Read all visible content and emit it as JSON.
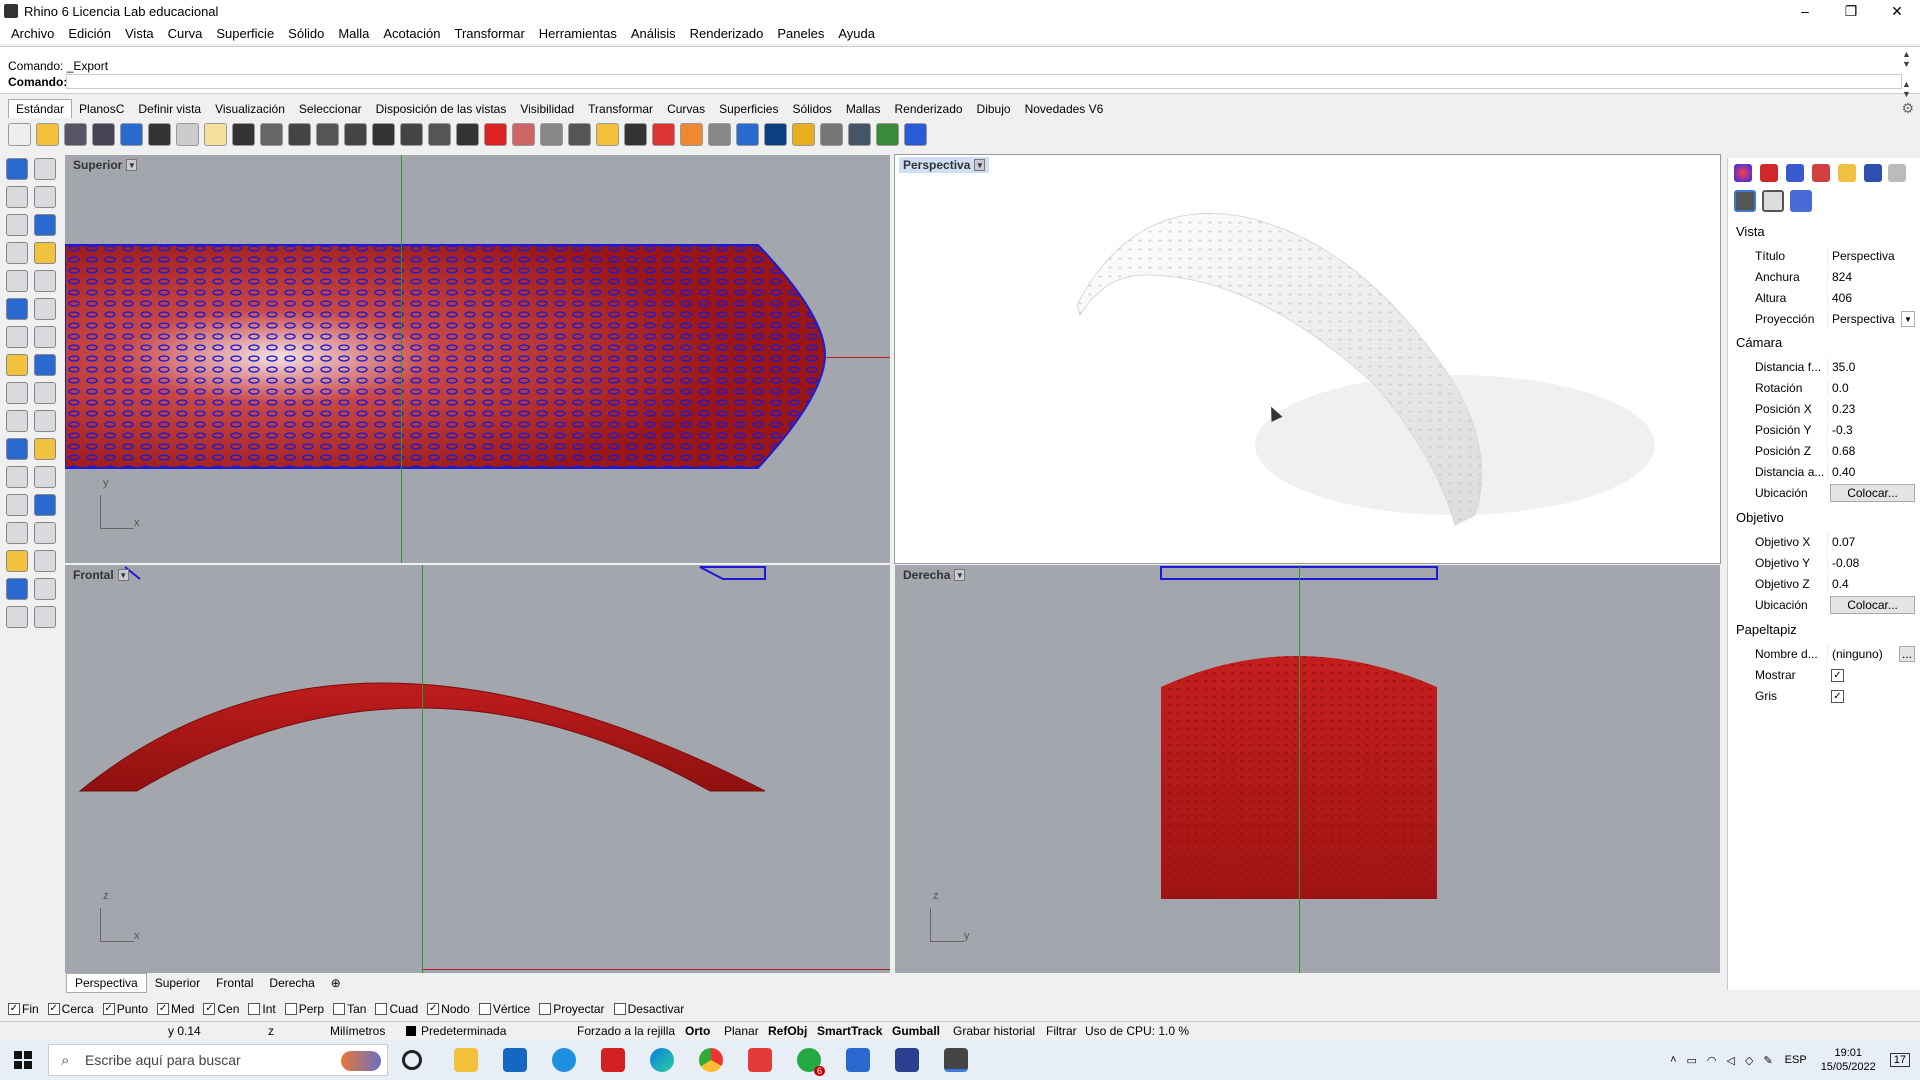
{
  "window": {
    "title": "Rhino 6 Licencia Lab educacional",
    "min": "–",
    "max": "❐",
    "close": "✕"
  },
  "menu": [
    "Archivo",
    "Edición",
    "Vista",
    "Curva",
    "Superficie",
    "Sólido",
    "Malla",
    "Acotación",
    "Transformar",
    "Herramientas",
    "Análisis",
    "Renderizado",
    "Paneles",
    "Ayuda"
  ],
  "command": {
    "history": "Comando: _Export",
    "prompt": "Comando:",
    "value": ""
  },
  "toolbar_tabs": [
    "Estándar",
    "PlanosC",
    "Definir vista",
    "Visualización",
    "Seleccionar",
    "Disposición de las vistas",
    "Visibilidad",
    "Transformar",
    "Curvas",
    "Superficies",
    "Sólidos",
    "Mallas",
    "Renderizado",
    "Dibujo",
    "Novedades V6"
  ],
  "toolbar_icons": [
    "new-icon",
    "open-icon",
    "save-icon",
    "print-icon",
    "import-icon",
    "cut-icon",
    "copy-icon",
    "paste-icon",
    "undo-icon",
    "pan-icon",
    "move-view-icon",
    "zoom-icon",
    "zoom-window-icon",
    "zoom-extents-icon",
    "zoom-selected-icon",
    "rotate-view-icon",
    "four-views-icon",
    "car-icon",
    "bus-icon",
    "cplane-icon",
    "grid-icon",
    "bulb-icon",
    "lock-icon",
    "layer-icon",
    "color-icon",
    "material-icon",
    "sphere-icon",
    "render-icon",
    "filter-icon",
    "gear-icon",
    "options-icon",
    "globe-icon",
    "help-icon"
  ],
  "viewports": {
    "top": {
      "label": "Superior"
    },
    "perspective": {
      "label": "Perspectiva"
    },
    "front": {
      "label": "Frontal"
    },
    "right": {
      "label": "Derecha"
    }
  },
  "gizmo": {
    "top": {
      "v": "y",
      "h": "x"
    },
    "front": {
      "v": "z",
      "h": "x"
    },
    "right": {
      "v": "z",
      "h": "y"
    }
  },
  "viewport_tabs": [
    "Perspectiva",
    "Superior",
    "Frontal",
    "Derecha"
  ],
  "viewport_tab_add": "⊕",
  "osnaps": [
    {
      "label": "Fin",
      "checked": true
    },
    {
      "label": "Cerca",
      "checked": true
    },
    {
      "label": "Punto",
      "checked": true
    },
    {
      "label": "Med",
      "checked": true
    },
    {
      "label": "Cen",
      "checked": true
    },
    {
      "label": "Int",
      "checked": false
    },
    {
      "label": "Perp",
      "checked": false
    },
    {
      "label": "Tan",
      "checked": false
    },
    {
      "label": "Cuad",
      "checked": false
    },
    {
      "label": "Nodo",
      "checked": true
    },
    {
      "label": "Vértice",
      "checked": false
    },
    {
      "label": "Proyectar",
      "checked": false
    },
    {
      "label": "Desactivar",
      "checked": false
    }
  ],
  "status": {
    "y": "y 0.14",
    "z": "z",
    "units": "Milímetros",
    "layer": "Predeterminada",
    "grid_snap": "Forzado a la rejilla",
    "ortho": "Orto",
    "planar": "Planar",
    "refobj": "RefObj",
    "smarttrack": "SmartTrack",
    "gumball": "Gumball",
    "history": "Grabar historial",
    "filter": "Filtrar",
    "cpu": "Uso de CPU: 1.0 %"
  },
  "panel": {
    "section_view": "Vista",
    "title_k": "Título",
    "title_v": "Perspectiva",
    "width_k": "Anchura",
    "width_v": "824",
    "height_k": "Altura",
    "height_v": "406",
    "proj_k": "Proyección",
    "proj_v": "Perspectiva",
    "section_camera": "Cámara",
    "lens_k": "Distancia f...",
    "lens_v": "35.0",
    "rot_k": "Rotación",
    "rot_v": "0.0",
    "px_k": "Posición X",
    "px_v": "0.23",
    "py_k": "Posición Y",
    "py_v": "-0.3",
    "pz_k": "Posición Z",
    "pz_v": "0.68",
    "dist_k": "Distancia a...",
    "dist_v": "0.40",
    "loc_k": "Ubicación",
    "loc_btn": "Colocar...",
    "section_target": "Objetivo",
    "tx_k": "Objetivo X",
    "tx_v": "0.07",
    "ty_k": "Objetivo Y",
    "ty_v": "-0.08",
    "tz_k": "Objetivo Z",
    "tz_v": "0.4",
    "tloc_k": "Ubicación",
    "tloc_btn": "Colocar...",
    "section_wall": "Papeltapiz",
    "wname_k": "Nombre d...",
    "wname_v": "(ninguno)",
    "wname_btn": "...",
    "show_k": "Mostrar",
    "show_checked": true,
    "gray_k": "Gris",
    "gray_checked": true
  },
  "taskbar": {
    "search": "Escribe aquí para buscar",
    "lang": "ESP",
    "time": "19:01",
    "date": "15/05/2022",
    "notif": "17",
    "whatsapp_badge": "6"
  },
  "colors": {
    "object_red": "#b01818",
    "selection_blue": "#1010d0",
    "viewport_bg": "#a3a7ad",
    "perspective_bg": "#ffffff"
  }
}
